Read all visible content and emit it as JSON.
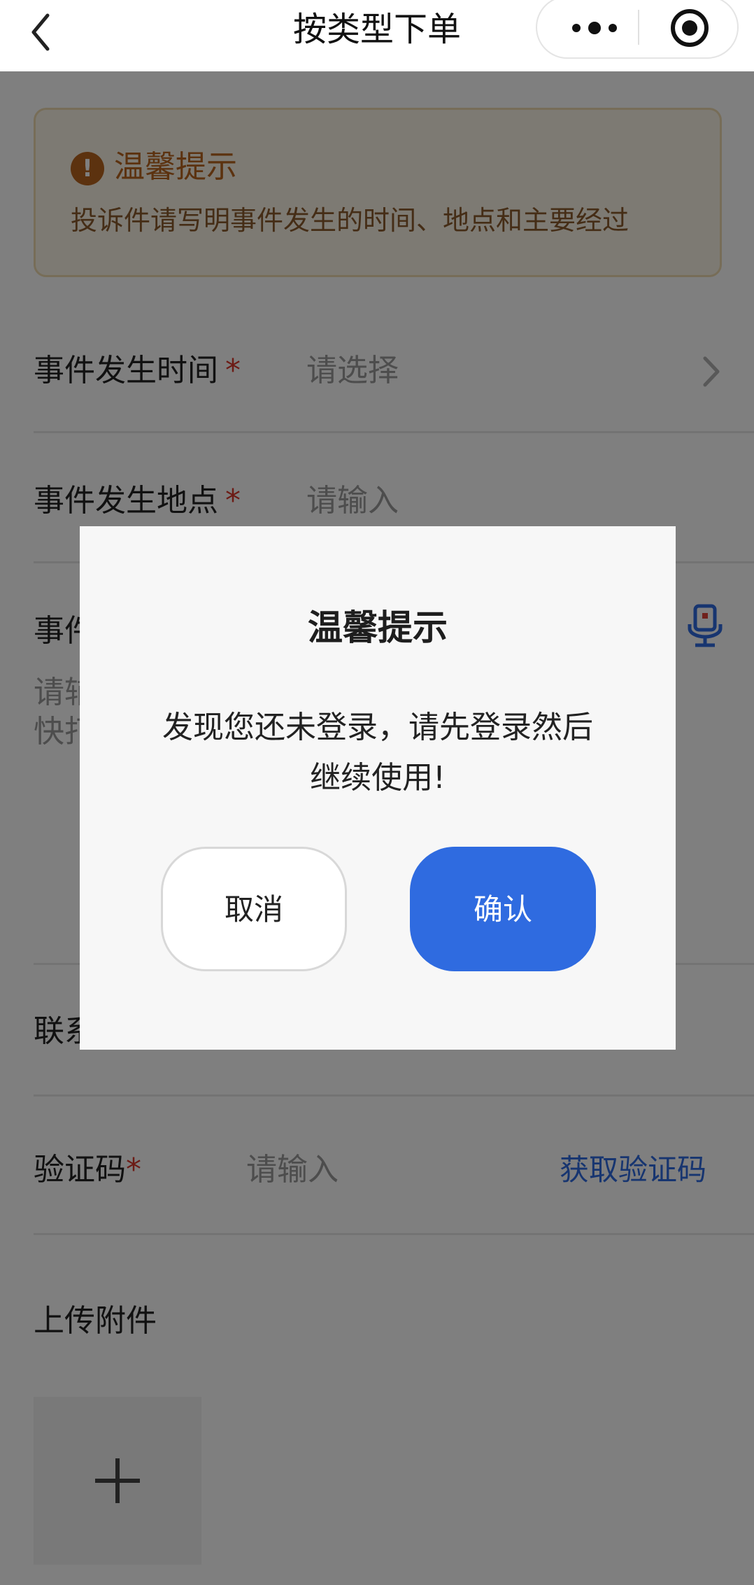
{
  "navbar": {
    "title": "按类型下单"
  },
  "notice": {
    "icon_symbol": "!",
    "title": "温馨提示",
    "text": "投诉件请写明事件发生的时间、地点和主要经过"
  },
  "form": {
    "time": {
      "label": "事件发生时间",
      "required_mark": "*",
      "placeholder": "请选择"
    },
    "place": {
      "label": "事件发生地点",
      "required_mark": "*",
      "placeholder": "请输入"
    },
    "desc": {
      "label_visible": "事件",
      "placeholder_line1": "请辅",
      "placeholder_line2": "快打"
    },
    "contact": {
      "label_visible": "联系"
    },
    "code": {
      "label": "验证码",
      "required_mark": "*",
      "placeholder": "请输入",
      "action": "获取验证码"
    },
    "upload": {
      "label": "上传附件",
      "plus_symbol": "+"
    }
  },
  "modal": {
    "title": "温馨提示",
    "message_line1": "发现您还未登录，请先登录然后",
    "message_line2": "继续使用!",
    "cancel_label": "取消",
    "confirm_label": "确认"
  },
  "colors": {
    "accent": "#2f6be0",
    "required": "#d9362b",
    "notice_text": "#8a5a2c",
    "notice_title": "#b8641e"
  },
  "icons": [
    "back-icon",
    "more-icon",
    "target-icon",
    "warning-icon",
    "chevron-right-icon",
    "microphone-icon",
    "plus-icon"
  ]
}
